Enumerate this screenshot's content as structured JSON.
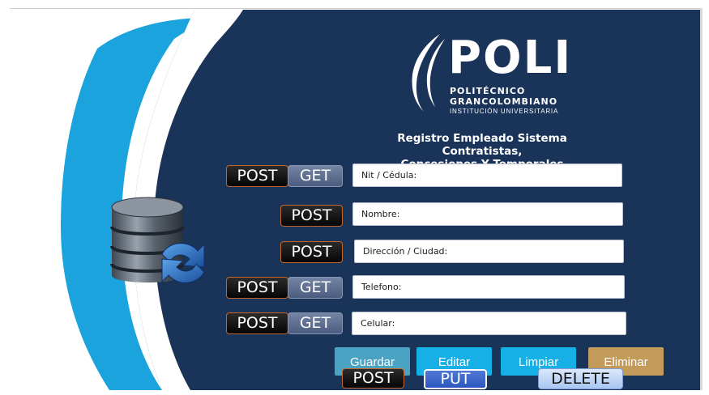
{
  "logo": {
    "wordmark": "POLI",
    "line1": "POLITÉCNICO",
    "line2": "GRANCOLOMBIANO",
    "line3": "INSTITUCIÓN UNIVERSITARIA"
  },
  "title": {
    "line1": "Registro Empleado Sistema Contratistas,",
    "line2": "Concesiones  Y Temporales"
  },
  "methods": {
    "post": "POST",
    "get": "GET",
    "put": "PUT",
    "delete": "DELETE"
  },
  "fields": {
    "nit": "Nit  / Cédula:",
    "nombre": "Nombre:",
    "direccion": "Dirección / Ciudad:",
    "telefono": "Telefono:",
    "celular": "Celular:"
  },
  "actions": {
    "guardar": "Guardar",
    "editar": "Editar",
    "limpiar": "Limpiar",
    "eliminar": "Eliminar"
  },
  "icons": {
    "database": "database-sync-icon",
    "logo_mark": "poli-flame-icon"
  },
  "colors": {
    "navy": "#1a3358",
    "cyan": "#1aa3dc",
    "guardar": "#4aa3c2",
    "editar": "#17b0e6",
    "limpiar": "#17b0e6",
    "eliminar": "#c49a5b"
  }
}
